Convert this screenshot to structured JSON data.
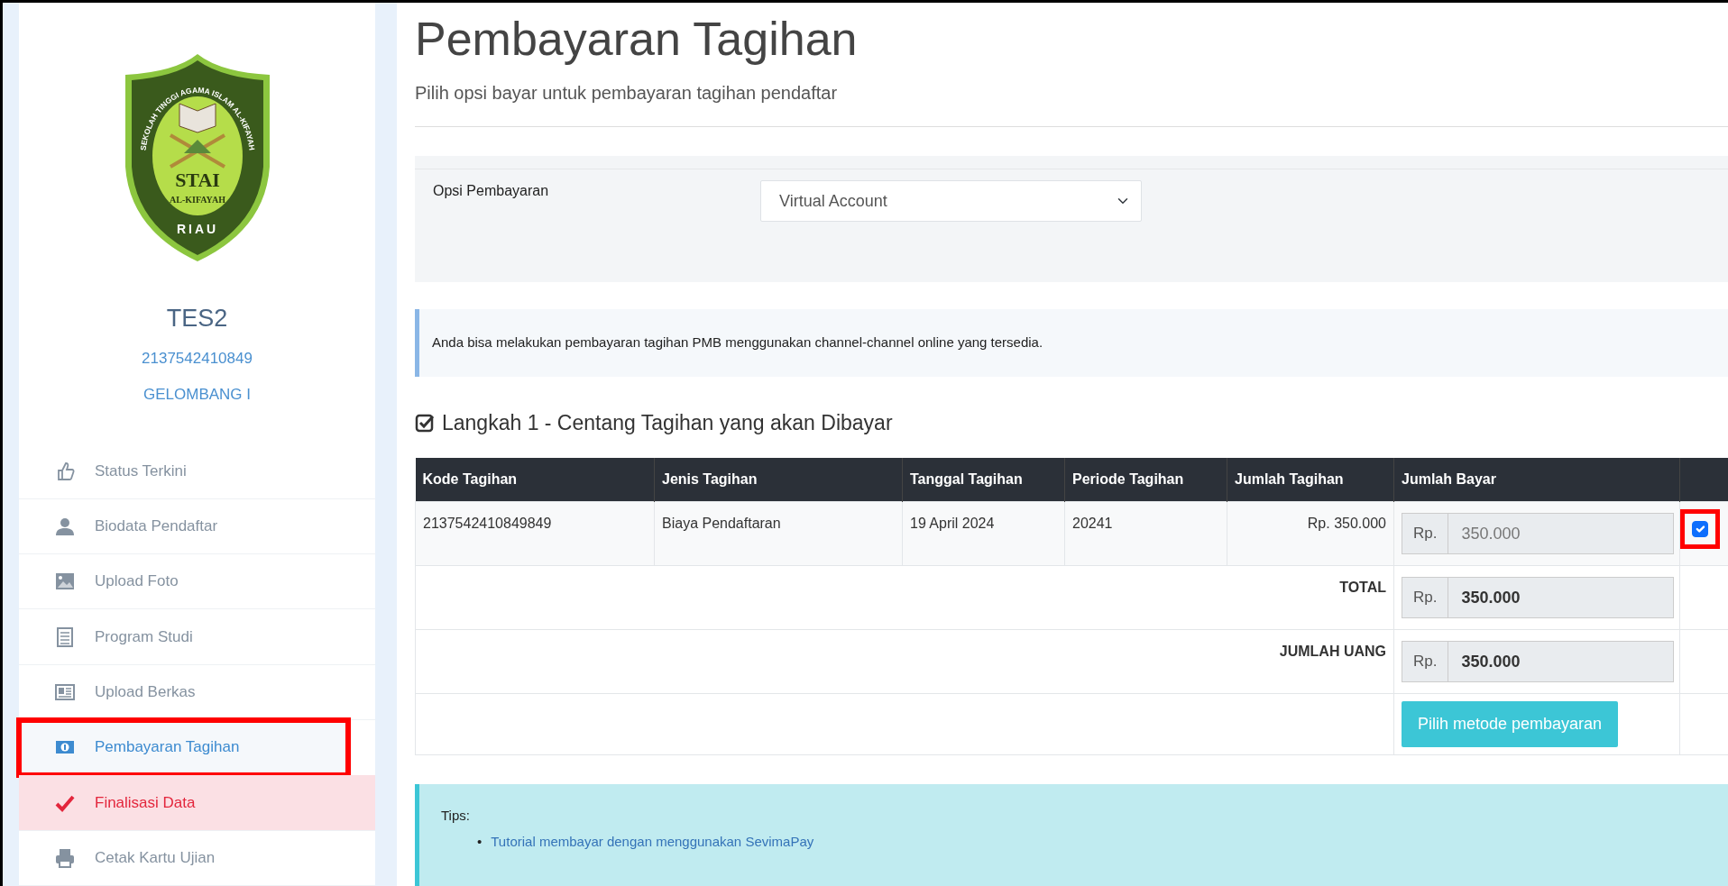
{
  "profile": {
    "logo": {
      "ring_text": "SEKOLAH TINGGI AGAMA ISLAM AL-KIFAYAH",
      "name": "STAI",
      "subname": "AL-KIFAYAH",
      "place": "RIAU"
    },
    "name": "TES2",
    "number": "2137542410849",
    "wave": "GELOMBANG I"
  },
  "sidebar": {
    "items": [
      {
        "label": "Status Terkini",
        "selected": false,
        "flagged": false,
        "highlighted": false
      },
      {
        "label": "Biodata Pendaftar",
        "selected": false,
        "flagged": false,
        "highlighted": false
      },
      {
        "label": "Upload Foto",
        "selected": false,
        "flagged": false,
        "highlighted": false
      },
      {
        "label": "Program Studi",
        "selected": false,
        "flagged": false,
        "highlighted": false
      },
      {
        "label": "Upload Berkas",
        "selected": false,
        "flagged": false,
        "highlighted": false
      },
      {
        "label": "Pembayaran Tagihan",
        "selected": true,
        "flagged": false,
        "highlighted": true
      },
      {
        "label": "Finalisasi Data",
        "selected": false,
        "flagged": true,
        "highlighted": false
      },
      {
        "label": "Cetak Kartu Ujian",
        "selected": false,
        "flagged": false,
        "highlighted": false
      }
    ]
  },
  "page": {
    "title": "Pembayaran Tagihan",
    "subtitle": "Pilih opsi bayar untuk pembayaran tagihan pendaftar"
  },
  "payment_option": {
    "label": "Opsi Pembayaran",
    "value": "Virtual Account"
  },
  "info": "Anda bisa melakukan pembayaran tagihan PMB menggunakan channel-channel online yang tersedia.",
  "step_heading": "Langkah 1 - Centang Tagihan yang akan Dibayar",
  "table": {
    "columns": [
      "Kode Tagihan",
      "Jenis Tagihan",
      "Tanggal Tagihan",
      "Periode Tagihan",
      "Jumlah Tagihan",
      "Jumlah Bayar"
    ],
    "rows": [
      {
        "cells": [
          "2137542410849849",
          "Biaya Pendaftaran",
          "19 April 2024",
          "20241",
          "Rp. 350.000"
        ],
        "currency": "Rp.",
        "pay": "350.000",
        "checked": true,
        "highlighted": true
      }
    ],
    "summary": [
      {
        "label": "TOTAL",
        "currency": "Rp.",
        "value": "350.000"
      },
      {
        "label": "JUMLAH UANG",
        "currency": "Rp.",
        "value": "350.000"
      }
    ],
    "button": "Pilih metode pembayaran"
  },
  "tips": {
    "title": "Tips:",
    "links": [
      {
        "bullet": "•",
        "text": "Tutorial membayar dengan menggunakan SevimaPay"
      }
    ]
  }
}
